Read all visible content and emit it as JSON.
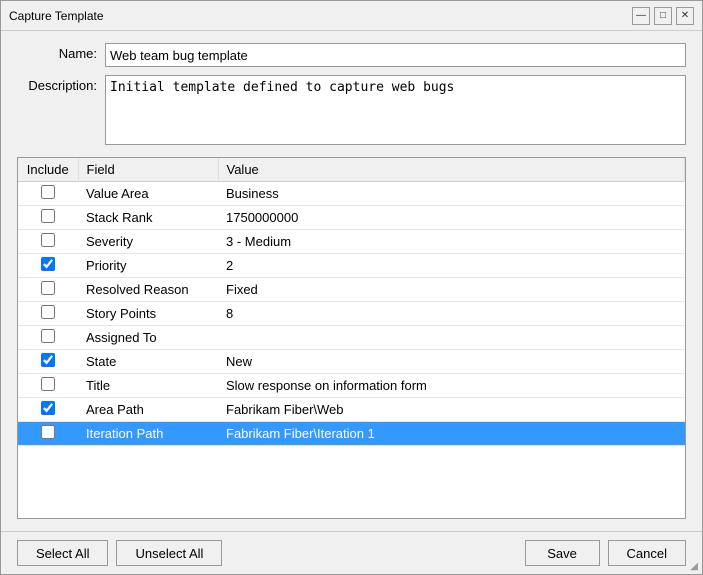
{
  "window": {
    "title": "Capture Template"
  },
  "title_controls": {
    "minimize": "—",
    "maximize": "□",
    "close": "✕"
  },
  "form": {
    "name_label": "Name:",
    "name_value": "Web team bug template",
    "description_label": "Description:",
    "description_value": "Initial template defined to capture web bugs"
  },
  "table": {
    "headers": {
      "include": "Include",
      "field": "Field",
      "value": "Value"
    },
    "rows": [
      {
        "checked": false,
        "field": "Value Area",
        "value": "Business",
        "selected": false
      },
      {
        "checked": false,
        "field": "Stack Rank",
        "value": "1750000000",
        "selected": false
      },
      {
        "checked": false,
        "field": "Severity",
        "value": "3 - Medium",
        "selected": false
      },
      {
        "checked": true,
        "field": "Priority",
        "value": "2",
        "selected": false
      },
      {
        "checked": false,
        "field": "Resolved Reason",
        "value": "Fixed",
        "selected": false
      },
      {
        "checked": false,
        "field": "Story Points",
        "value": "8",
        "selected": false
      },
      {
        "checked": false,
        "field": "Assigned To",
        "value": "",
        "selected": false
      },
      {
        "checked": true,
        "field": "State",
        "value": "New",
        "selected": false
      },
      {
        "checked": false,
        "field": "Title",
        "value": "Slow response on information form",
        "selected": false
      },
      {
        "checked": true,
        "field": "Area Path",
        "value": "Fabrikam Fiber\\Web",
        "selected": false
      },
      {
        "checked": false,
        "field": "Iteration Path",
        "value": "Fabrikam Fiber\\Iteration 1",
        "selected": true
      }
    ]
  },
  "buttons": {
    "select_all": "Select All",
    "unselect_all": "Unselect All",
    "save": "Save",
    "cancel": "Cancel"
  }
}
